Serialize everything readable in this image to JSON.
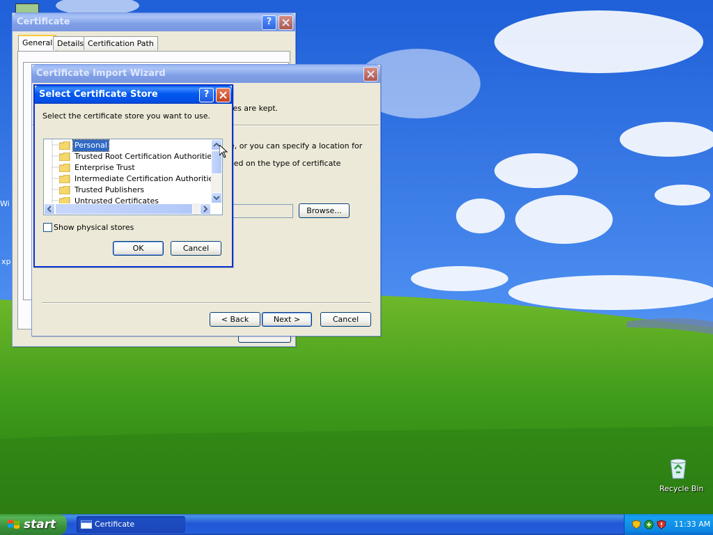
{
  "desktop": {
    "icons": {
      "recycle_bin": "Recycle Bin"
    },
    "partial_left_texts": [
      "Wi",
      "xp"
    ]
  },
  "certificate_window": {
    "title": "Certificate",
    "tabs": [
      "General",
      "Details",
      "Certification Path"
    ]
  },
  "wizard": {
    "title": "Certificate Import Wizard",
    "text_lines": [
      "tes are kept.",
      "e, or you can specify a location for",
      "sed on the type of certificate"
    ],
    "browse_label": "Browse...",
    "back_label": "< Back",
    "next_label": "Next >",
    "cancel_label": "Cancel"
  },
  "store_dialog": {
    "title": "Select Certificate Store",
    "instruction": "Select the certificate store you want to use.",
    "stores": [
      "Personal",
      "Trusted Root Certification Authorities",
      "Enterprise Trust",
      "Intermediate Certification Authorities",
      "Trusted Publishers",
      "Untrusted Certificates"
    ],
    "selected_store": "Personal",
    "show_physical_label": "Show physical stores",
    "show_physical_checked": false,
    "ok_label": "OK",
    "cancel_label": "Cancel"
  },
  "taskbar": {
    "start_label": "start",
    "task_label": "Certificate",
    "clock": "11:33 AM"
  },
  "colors": {
    "title_active": "#0058ee",
    "title_inactive": "#7e9ee6",
    "window_face": "#ece9d8",
    "selection": "#316ac5",
    "taskbar": "#245edb",
    "start_green": "#3a913a"
  }
}
